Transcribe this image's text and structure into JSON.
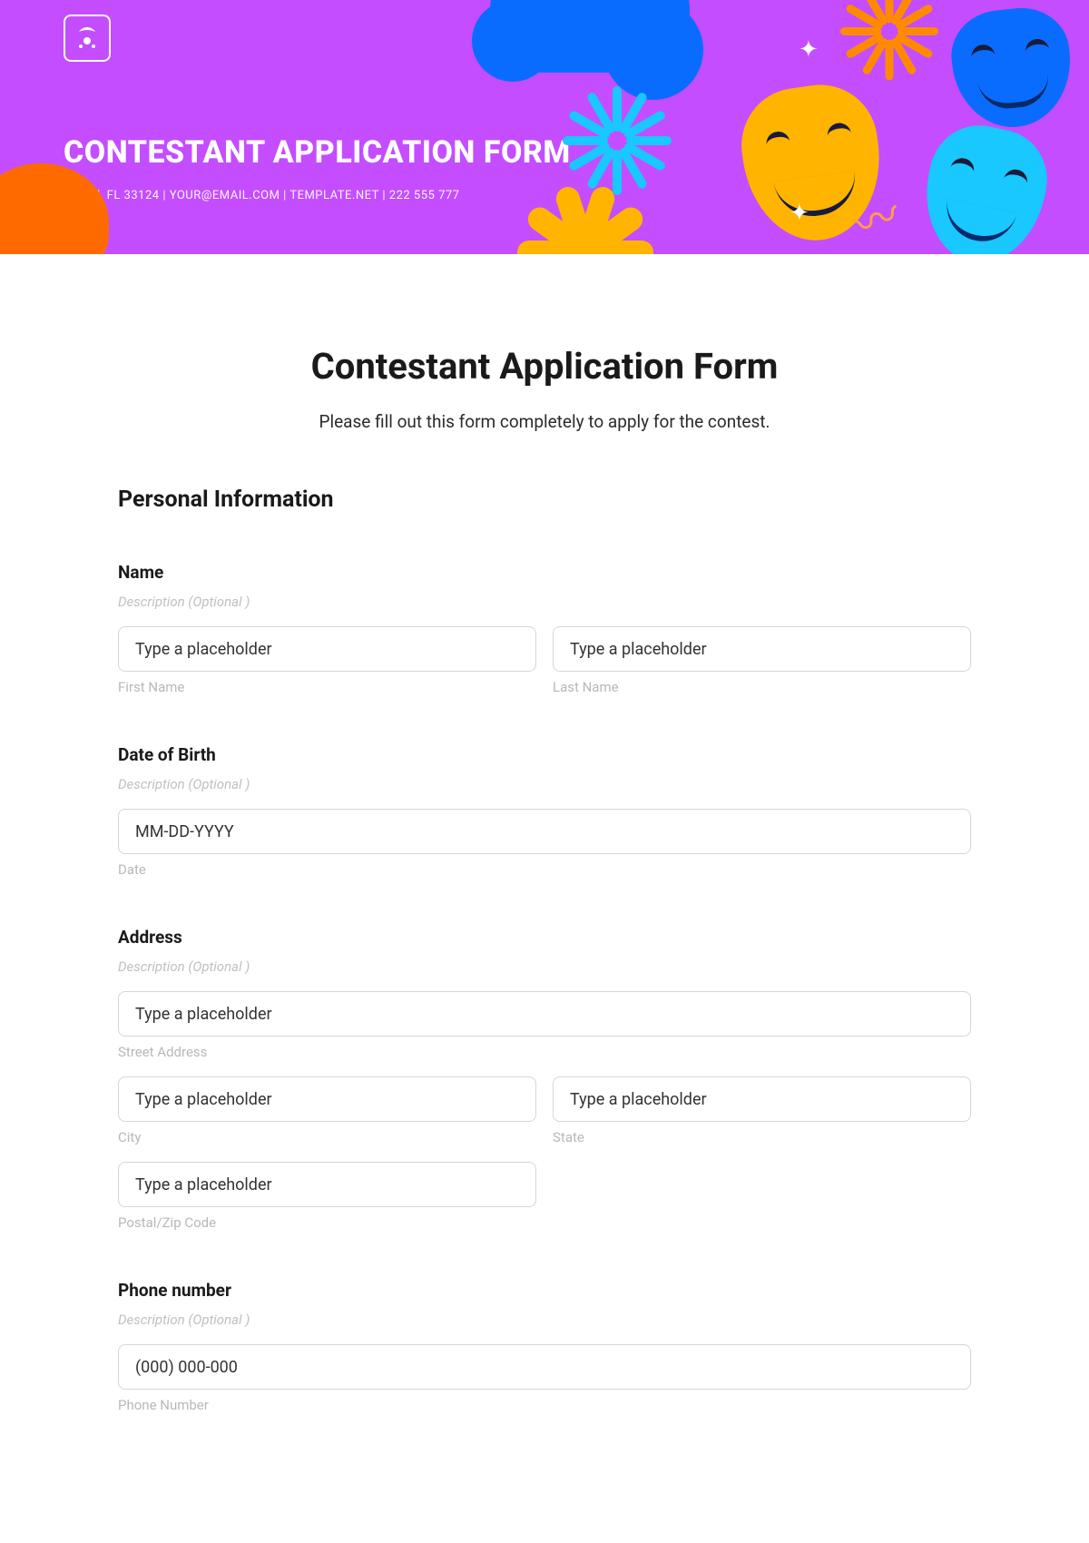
{
  "hero": {
    "title": "CONTESTANT APPLICATION FORM",
    "subtitle": "MIAMI, FL 33124 | YOUR@EMAIL.COM | TEMPLATE.NET | 222 555 777"
  },
  "doc": {
    "title": "Contestant Application Form",
    "subtitle": "Please fill out this form completely to apply for the contest."
  },
  "section1": "Personal Information",
  "desc_optional": "Description (Optional )",
  "placeholder_generic": "Type a placeholder",
  "name": {
    "label": "Name",
    "first_sub": "First Name",
    "last_sub": "Last Name"
  },
  "dob": {
    "label": "Date of Birth",
    "placeholder": "MM-DD-YYYY",
    "sub": "Date"
  },
  "address": {
    "label": "Address",
    "street_sub": "Street Address",
    "city_sub": "City",
    "state_sub": "State",
    "zip_sub": "Postal/Zip Code"
  },
  "phone": {
    "label": "Phone number",
    "placeholder": "(000) 000-000",
    "sub": "Phone Number"
  }
}
